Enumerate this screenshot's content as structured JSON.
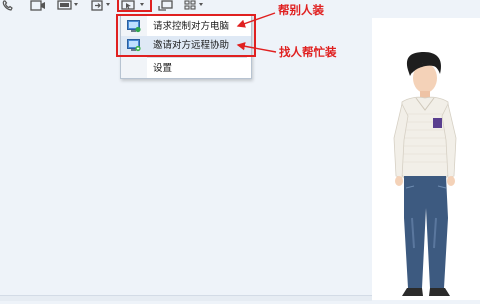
{
  "toolbar": {
    "buttons": [
      {
        "name": "voice-call-icon"
      },
      {
        "name": "video-call-icon"
      },
      {
        "name": "screen-share-icon"
      },
      {
        "name": "file-transfer-icon"
      },
      {
        "name": "remote-assist-icon"
      },
      {
        "name": "share-icon"
      },
      {
        "name": "apps-grid-icon"
      }
    ]
  },
  "menu": {
    "items": [
      {
        "label": "请求控制对方电脑",
        "icon": "request-control-icon"
      },
      {
        "label": "邀请对方远程协助",
        "icon": "invite-assist-icon"
      },
      {
        "label": "设置",
        "icon": ""
      }
    ]
  },
  "annotations": {
    "help_others": "帮别人装",
    "find_helper": "找人帮忙装",
    "color": "#e02020"
  },
  "avatar": {
    "description_icon": "user-avatar-figure"
  },
  "colors": {
    "background": "#eef3f9",
    "panel": "#ffffff",
    "accent_red": "#e02020"
  }
}
